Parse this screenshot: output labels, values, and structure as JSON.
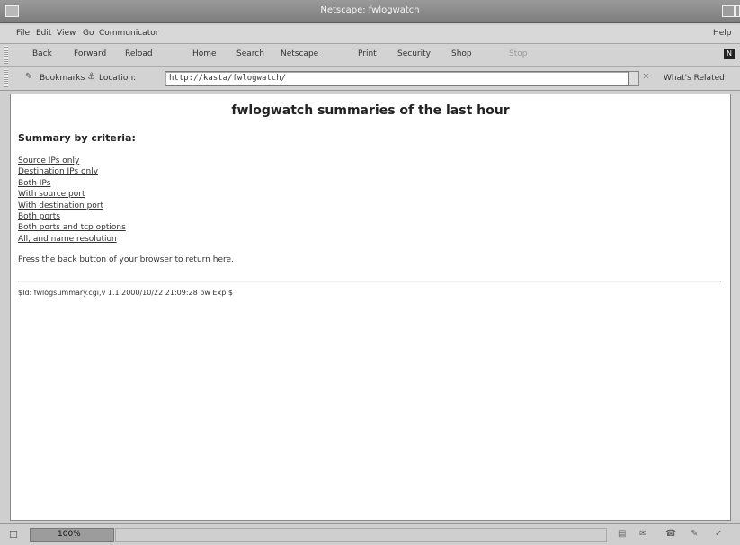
{
  "window": {
    "title": "Netscape: fwlogwatch"
  },
  "menu": {
    "file": "File",
    "edit": "Edit",
    "view": "View",
    "go": "Go",
    "communicator": "Communicator",
    "help": "Help"
  },
  "toolbar": {
    "back": "Back",
    "forward": "Forward",
    "reload": "Reload",
    "home": "Home",
    "search": "Search",
    "netscape": "Netscape",
    "print": "Print",
    "security": "Security",
    "shop": "Shop",
    "stop": "Stop"
  },
  "location": {
    "bookmarks": "Bookmarks",
    "location_label": "Location:",
    "url": "http://kasta/fwlogwatch/",
    "whats_related": "What's Related"
  },
  "page": {
    "heading": "fwlogwatch summaries of the last hour",
    "subheading": "Summary by criteria:",
    "links": [
      "Source IPs only",
      "Destination IPs only",
      "Both IPs",
      "With source port",
      "With destination port",
      "Both ports",
      "Both ports and tcp options",
      "All, and name resolution"
    ],
    "back_note": "Press the back button of your browser to return here.",
    "id_line": "$Id: fwlogsummary.cgi,v 1.1 2000/10/22 21:09:28 bw Exp $"
  },
  "status": {
    "progress": "100%"
  }
}
